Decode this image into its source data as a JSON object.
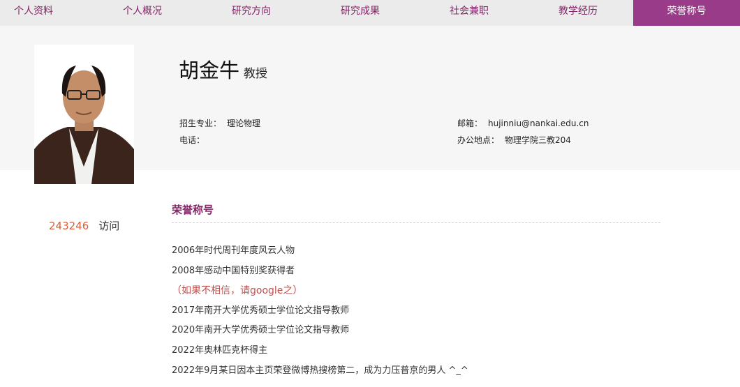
{
  "nav": {
    "items": [
      {
        "label": "个人资料"
      },
      {
        "label": "个人概况"
      },
      {
        "label": "研究方向"
      },
      {
        "label": "研究成果"
      },
      {
        "label": "社会兼职"
      },
      {
        "label": "教学经历"
      },
      {
        "label": "荣誉称号"
      }
    ],
    "active_index": 6
  },
  "profile": {
    "name": "胡金牛",
    "title": "教授",
    "major_label": "招生专业：",
    "major_value": "理论物理",
    "phone_label": "电话：",
    "phone_value": "",
    "email_label": "邮箱：",
    "email_value": "hujinniu@nankai.edu.cn",
    "office_label": "办公地点：",
    "office_value": "物理学院三教204"
  },
  "visits": {
    "count": "243246",
    "label": "访问"
  },
  "section": {
    "title": "荣誉称号",
    "items": [
      "2006年时代周刊年度风云人物",
      "2008年感动中国特别奖获得者",
      "（如果不相信，请google之）",
      "2017年南开大学优秀硕士学位论文指导教师",
      "2020年南开大学优秀硕士学位论文指导教师",
      "2022年奥林匹克杯得主",
      "2022年9月某日因本主页荣登微博热搜榜第二，成为力压普京的男人 ^_^"
    ]
  },
  "colors": {
    "accent": "#862468",
    "active_tab": "#9a3b8a",
    "visit_count": "#d9603b",
    "note_text": "#c0504d"
  }
}
